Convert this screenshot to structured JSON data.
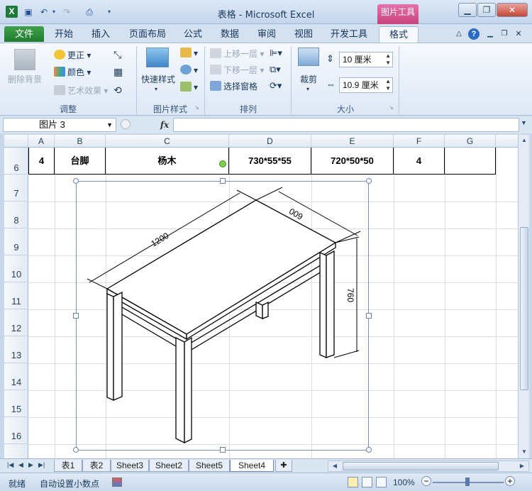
{
  "window": {
    "title": "表格 - Microsoft Excel",
    "context_tab": "图片工具",
    "buttons": [
      "minimize",
      "restore",
      "close"
    ]
  },
  "tabs": [
    {
      "label": "文件",
      "active": false
    },
    {
      "label": "开始",
      "active": false
    },
    {
      "label": "插入",
      "active": false
    },
    {
      "label": "页面布局",
      "active": false
    },
    {
      "label": "公式",
      "active": false
    },
    {
      "label": "数据",
      "active": false
    },
    {
      "label": "审阅",
      "active": false
    },
    {
      "label": "视图",
      "active": false
    },
    {
      "label": "开发工具",
      "active": false
    },
    {
      "label": "格式",
      "active": true
    }
  ],
  "ribbon": {
    "adjust": {
      "remove_bg": "删除背景",
      "corrections": "更正",
      "color": "颜色",
      "artistic": "艺术效果",
      "label": "调整"
    },
    "styles": {
      "quick_styles": "快速样式",
      "label": "图片样式"
    },
    "arrange": {
      "bring_forward": "上移一层",
      "send_backward": "下移一层",
      "selection_pane": "选择窗格",
      "label": "排列"
    },
    "size": {
      "crop": "裁剪",
      "height": "10 厘米",
      "width": "10.9 厘米",
      "label": "大小"
    }
  },
  "formula_bar": {
    "name_box": "图片 3",
    "fx": "fx",
    "formula": ""
  },
  "columns": [
    "A",
    "B",
    "C",
    "D",
    "E",
    "F",
    "G"
  ],
  "rows": [
    "6",
    "7",
    "8",
    "9",
    "10",
    "11",
    "12",
    "13",
    "14",
    "15",
    "16"
  ],
  "row6": [
    "4",
    "台脚",
    "杨木",
    "730*55*55",
    "720*50*50",
    "4",
    ""
  ],
  "drawing": {
    "dim_length": "1200",
    "dim_width": "600",
    "dim_height": "760"
  },
  "sheets": [
    {
      "label": "表1",
      "active": false
    },
    {
      "label": "表2",
      "active": false
    },
    {
      "label": "Sheet3",
      "active": false
    },
    {
      "label": "Sheet2",
      "active": false
    },
    {
      "label": "Sheet5",
      "active": false
    },
    {
      "label": "Sheet4",
      "active": true
    }
  ],
  "status": {
    "ready": "就绪",
    "auto_decimal": "自动设置小数点",
    "zoom": "100%"
  }
}
